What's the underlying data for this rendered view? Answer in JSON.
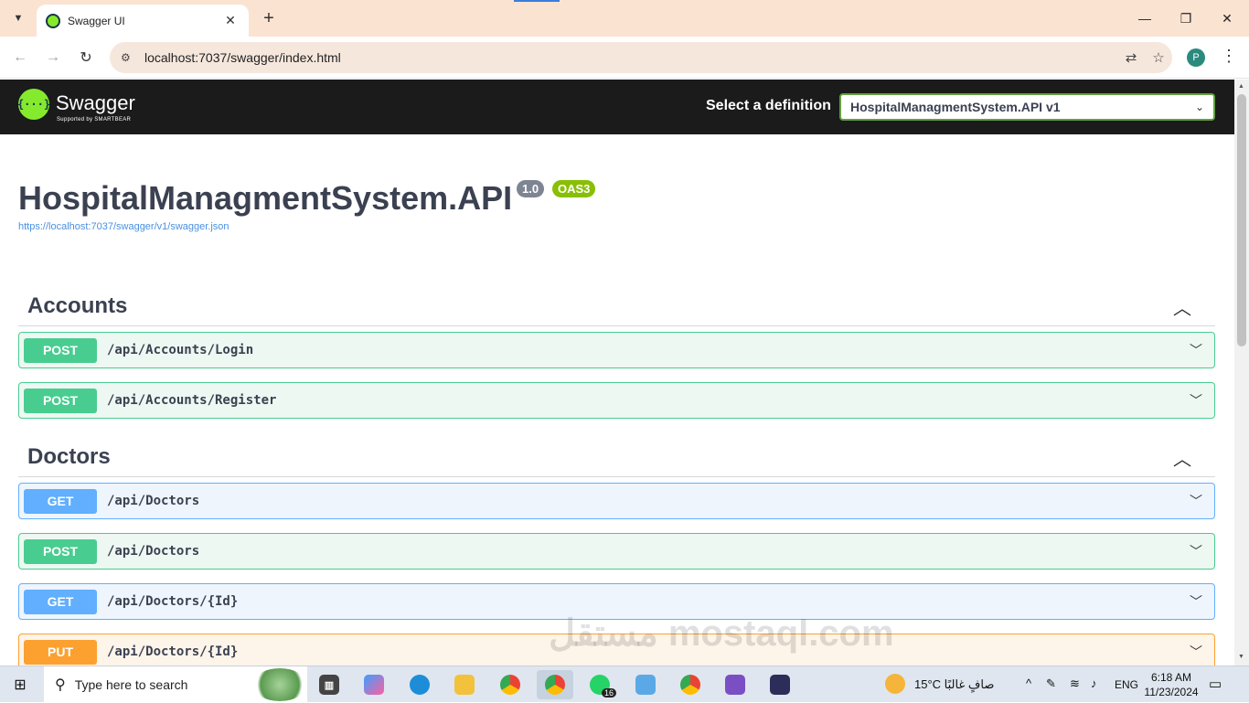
{
  "browser": {
    "tab_title": "Swagger UI",
    "url": "localhost:7037/swagger/index.html",
    "profile_initial": "P"
  },
  "header": {
    "brand": "Swagger",
    "brand_sub": "Supported by SMARTBEAR",
    "select_label": "Select a definition",
    "selected_definition": "HospitalManagmentSystem.API v1"
  },
  "info": {
    "title": "HospitalManagmentSystem.API",
    "version": "1.0",
    "oas": "OAS3",
    "spec_url": "https://localhost:7037/swagger/v1/swagger.json"
  },
  "tags": [
    {
      "name": "Accounts",
      "operations": [
        {
          "method": "POST",
          "path": "/api/Accounts/Login"
        },
        {
          "method": "POST",
          "path": "/api/Accounts/Register"
        }
      ]
    },
    {
      "name": "Doctors",
      "operations": [
        {
          "method": "GET",
          "path": "/api/Doctors"
        },
        {
          "method": "POST",
          "path": "/api/Doctors"
        },
        {
          "method": "GET",
          "path": "/api/Doctors/{Id}"
        },
        {
          "method": "PUT",
          "path": "/api/Doctors/{Id}"
        }
      ]
    }
  ],
  "colors": {
    "post": "#49cc90",
    "get": "#61affe",
    "put": "#fca130",
    "swagger_green": "#85ea2d",
    "header_bg": "#1b1b1b"
  },
  "taskbar": {
    "search_placeholder": "Type here to search",
    "whatsapp_badge": "16",
    "weather": "15°C  صافٍ غالبًا",
    "language": "ENG",
    "time": "6:18 AM",
    "date": "11/23/2024"
  },
  "watermark": "مستقل mostaql.com"
}
